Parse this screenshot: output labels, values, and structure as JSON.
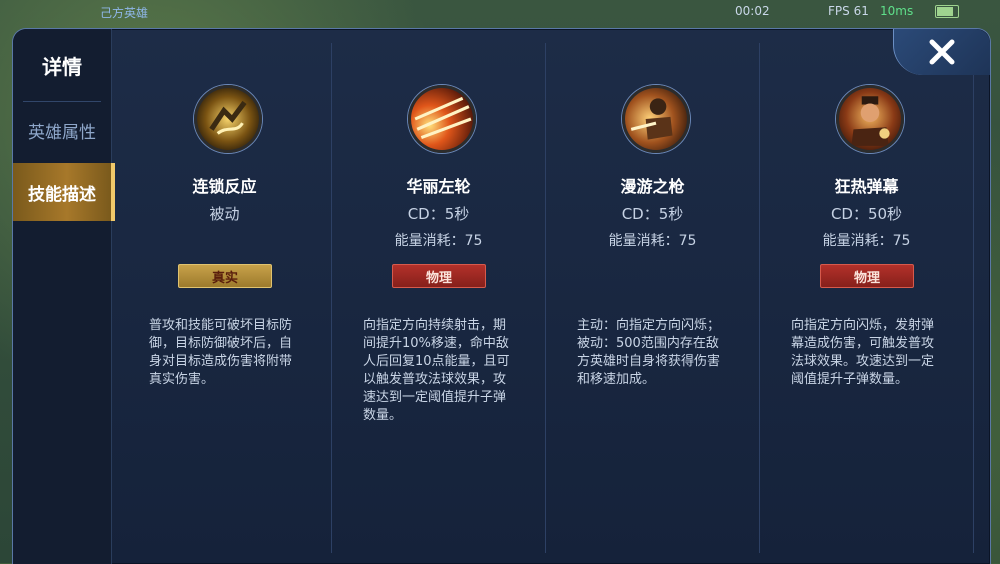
{
  "status_bar": {
    "team_label": "己方英雄",
    "time": "00:02",
    "fps": "FPS 61",
    "latency": "10ms"
  },
  "sidebar": {
    "title": "详情",
    "items": [
      {
        "label": "英雄属性",
        "active": false
      },
      {
        "label": "技能描述",
        "active": true
      }
    ]
  },
  "skills": [
    {
      "icon": "chain-reaction-icon",
      "name": "连锁反应",
      "sub": "被动",
      "energy": "",
      "badge": "真实",
      "badge_type": "true-damage",
      "description": "普攻和技能可破坏目标防\n御，目标防御破坏后，自\n身对目标造成伤害将附带\n真实伤害。"
    },
    {
      "icon": "gorgeous-revolver-icon",
      "name": "华丽左轮",
      "sub": "CD：5秒",
      "energy": "能量消耗：75",
      "badge": "物理",
      "badge_type": "physical",
      "description": "向指定方向持续射击，期\n间提升10%移速，命中敌\n人后回复10点能量，且可\n以触发普攻法球效果，攻\n速达到一定阈值提升子弹\n数量。"
    },
    {
      "icon": "roaming-gun-icon",
      "name": "漫游之枪",
      "sub": "CD：5秒",
      "energy": "能量消耗：75",
      "badge": "",
      "badge_type": "",
      "description": "主动：向指定方向闪烁；\n被动：500范围内存在敌\n方英雄时自身将获得伤害\n和移速加成。"
    },
    {
      "icon": "frenzied-barrage-icon",
      "name": "狂热弹幕",
      "sub": "CD：50秒",
      "energy": "能量消耗：75",
      "badge": "物理",
      "badge_type": "physical",
      "description": "向指定方向闪烁，发射弹\n幕造成伤害，可触发普攻\n法球效果。攻速达到一定\n阈值提升子弹数量。"
    }
  ],
  "colors": {
    "panel_bg": "#1d2c47",
    "active_tab": "#a7782a",
    "true_badge": "#c8a24a",
    "physical_badge": "#b3312a"
  }
}
